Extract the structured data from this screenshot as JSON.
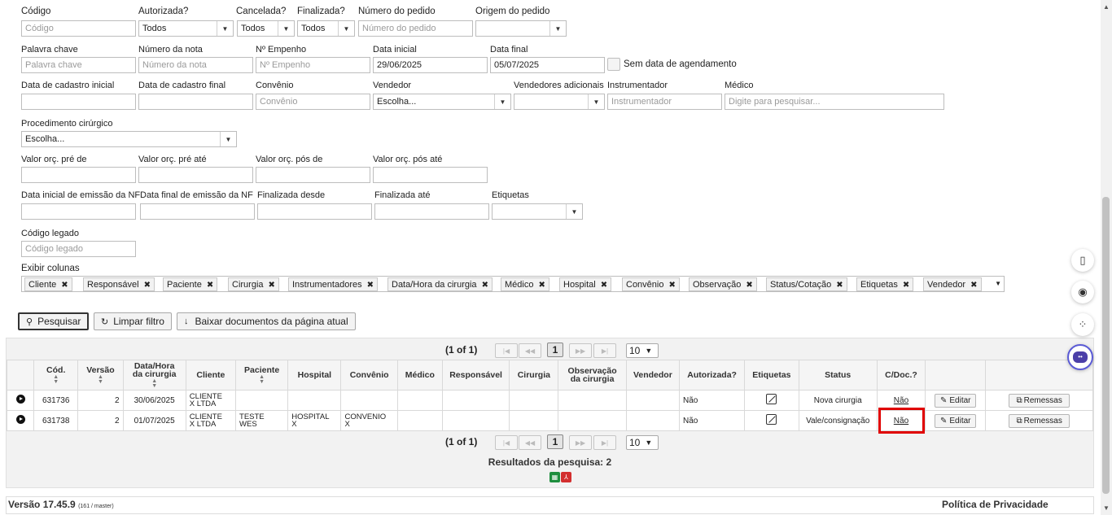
{
  "filters": {
    "row1": {
      "codigo": {
        "label": "Código",
        "placeholder": "Código"
      },
      "autorizada": {
        "label": "Autorizada?",
        "value": "Todos"
      },
      "cancelada": {
        "label": "Cancelada?",
        "value": "Todos"
      },
      "finalizada": {
        "label": "Finalizada?",
        "value": "Todos"
      },
      "numero_pedido": {
        "label": "Número do pedido",
        "placeholder": "Número do pedido"
      },
      "origem_pedido": {
        "label": "Origem do pedido",
        "value": ""
      }
    },
    "row2": {
      "palavra_chave": {
        "label": "Palavra chave",
        "placeholder": "Palavra chave"
      },
      "numero_nota": {
        "label": "Número da nota",
        "placeholder": "Número da nota"
      },
      "empenho": {
        "label": "Nº Empenho",
        "placeholder": "Nº Empenho"
      },
      "data_inicial": {
        "label": "Data inicial",
        "value": "29/06/2025"
      },
      "data_final": {
        "label": "Data final",
        "value": "05/07/2025"
      },
      "sem_data": {
        "label": "Sem data de agendamento"
      }
    },
    "row3": {
      "cadastro_inicial": {
        "label": "Data de cadastro inicial"
      },
      "cadastro_final": {
        "label": "Data de cadastro final"
      },
      "convenio": {
        "label": "Convênio",
        "placeholder": "Convênio"
      },
      "vendedor": {
        "label": "Vendedor",
        "value": "Escolha..."
      },
      "vendedores_adicionais": {
        "label": "Vendedores adicionais",
        "value": ""
      },
      "instrumentador": {
        "label": "Instrumentador",
        "placeholder": "Instrumentador"
      },
      "medico": {
        "label": "Médico",
        "placeholder": "Digite para pesquisar..."
      }
    },
    "procedimento": {
      "label": "Procedimento cirúrgico",
      "value": "Escolha..."
    },
    "row5": {
      "orc_pre_de": {
        "label": "Valor orç. pré de"
      },
      "orc_pre_ate": {
        "label": "Valor orç. pré até"
      },
      "orc_pos_de": {
        "label": "Valor orç. pós de"
      },
      "orc_pos_ate": {
        "label": "Valor orç. pós até"
      }
    },
    "row6": {
      "nf_inicial": {
        "label": "Data inicial de emissão da NF"
      },
      "nf_final": {
        "label": "Data final de emissão da NF"
      },
      "finalizada_desde": {
        "label": "Finalizada desde"
      },
      "finalizada_ate": {
        "label": "Finalizada até"
      },
      "etiquetas": {
        "label": "Etiquetas",
        "value": ""
      }
    },
    "codigo_legado": {
      "label": "Código legado",
      "placeholder": "Código legado"
    },
    "exibir_colunas": {
      "label": "Exibir colunas",
      "tags": [
        "Cliente",
        "Responsável",
        "Paciente",
        "Cirurgia",
        "Instrumentadores",
        "Data/Hora da cirurgia",
        "Médico",
        "Hospital",
        "Convênio",
        "Observação",
        "Status/Cotação",
        "Etiquetas",
        "Vendedor"
      ]
    }
  },
  "actions": {
    "pesquisar": "Pesquisar",
    "limpar": "Limpar filtro",
    "baixar": "Baixar documentos da página atual"
  },
  "pagination": {
    "info": "(1 of 1)",
    "current": "1",
    "per_page": "10"
  },
  "table": {
    "columns": {
      "cod": "Cód.",
      "versao": "Versão",
      "data_hora_1": "Data/Hora",
      "data_hora_2": "da cirurgia",
      "cliente": "Cliente",
      "paciente": "Paciente",
      "hospital": "Hospital",
      "convenio": "Convênio",
      "medico": "Médico",
      "responsavel": "Responsável",
      "cirurgia": "Cirurgia",
      "obs_1": "Observação",
      "obs_2": "da cirurgia",
      "vendedor": "Vendedor",
      "autorizada": "Autorizada?",
      "etiquetas": "Etiquetas",
      "status": "Status",
      "cdoc": "C/Doc.?"
    },
    "rows": [
      {
        "cod": "631736",
        "versao": "2",
        "data": "30/06/2025",
        "cliente_1": "CLIENTE",
        "cliente_2": "X LTDA",
        "paciente_1": "",
        "paciente_2": "",
        "hospital_1": "",
        "hospital_2": "",
        "convenio_1": "",
        "convenio_2": "",
        "autorizada": "Não",
        "status": "Nova cirurgia",
        "cdoc": "Não",
        "editar": "Editar",
        "remessas": "Remessas"
      },
      {
        "cod": "631738",
        "versao": "2",
        "data": "01/07/2025",
        "cliente_1": "CLIENTE",
        "cliente_2": "X LTDA",
        "paciente_1": "TESTE",
        "paciente_2": "WES",
        "hospital_1": "HOSPITAL",
        "hospital_2": "X",
        "convenio_1": "CONVENIO",
        "convenio_2": "X",
        "autorizada": "Não",
        "status": "Vale/consignação",
        "cdoc": "Não",
        "editar": "Editar",
        "remessas": "Remessas"
      }
    ]
  },
  "results": "Resultados da pesquisa: 2",
  "footer": {
    "version": "Versão 17.45.9",
    "build": "(161 / master)",
    "privacy": "Política de Privacidade"
  },
  "colors": {
    "highlight": "#e00000",
    "excel": "#1e8e3e",
    "pdf": "#d32f2f"
  }
}
